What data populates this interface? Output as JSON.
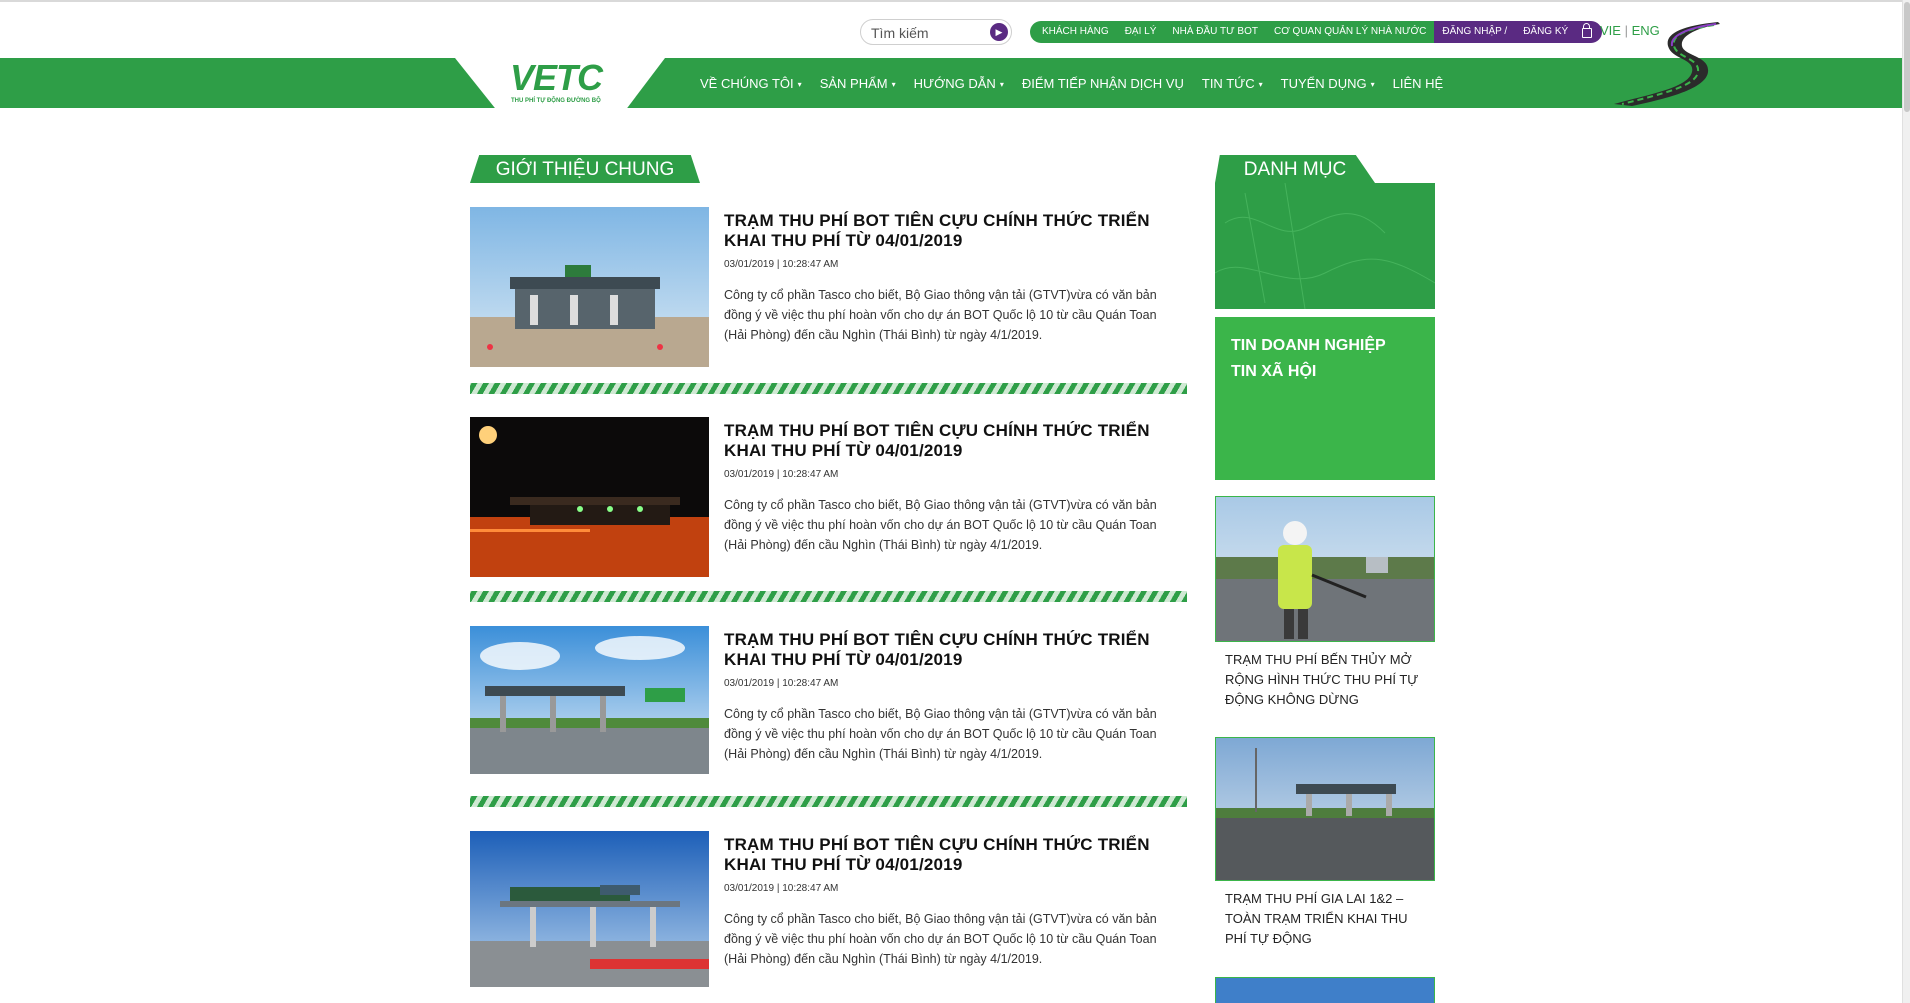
{
  "header": {
    "search": {
      "placeholder": "Tìm kiếm"
    },
    "quick_links": [
      "KHÁCH HÀNG",
      "ĐẠI LÝ",
      "NHÀ ĐẦU TƯ BOT",
      "CƠ QUAN QUẢN LÝ NHÀ NƯỚC"
    ],
    "account": {
      "login": "ĐĂNG NHẬP /",
      "register": "ĐĂNG KÝ"
    },
    "lang": {
      "vie": "VIE",
      "sep": "|",
      "eng": "ENG"
    },
    "brand_color": "#2e9e47",
    "accent_color": "#5a2a82"
  },
  "logo": {
    "mark": "VETC",
    "tagline": "THU PHÍ TỰ ĐỘNG ĐƯỜNG BỘ"
  },
  "nav": [
    {
      "label": "VỀ CHÚNG TÔI",
      "dropdown": true
    },
    {
      "label": "SẢN PHẨM",
      "dropdown": true
    },
    {
      "label": "HƯỚNG DẪN",
      "dropdown": true
    },
    {
      "label": "ĐIỂM TIẾP NHẬN DỊCH VỤ",
      "dropdown": false
    },
    {
      "label": "TIN TỨC",
      "dropdown": true
    },
    {
      "label": "TUYỂN DỤNG",
      "dropdown": true
    },
    {
      "label": "LIÊN HỆ",
      "dropdown": false
    }
  ],
  "main": {
    "section_title": "GIỚI THIỆU CHUNG",
    "posts": [
      {
        "title": "TRẠM THU PHÍ BOT TIÊN CỰU CHÍNH THỨC TRIỂN KHAI THU PHÍ TỪ 04/01/2019",
        "date": "03/01/2019 | 10:28:47 AM",
        "excerpt": "Công ty cổ phần Tasco cho biết, Bộ Giao thông vận tải (GTVT)vừa có văn bản đồng ý về việc thu phí hoàn vốn cho dự án BOT Quốc lộ 10 từ cầu Quán Toan (Hải Phòng) đến cầu Nghìn (Thái Bình) từ ngày 4/1/2019."
      },
      {
        "title": "TRẠM THU PHÍ BOT TIÊN CỰU CHÍNH THỨC TRIỂN KHAI THU PHÍ TỪ 04/01/2019",
        "date": "03/01/2019 | 10:28:47 AM",
        "excerpt": "Công ty cổ phần Tasco cho biết, Bộ Giao thông vận tải (GTVT)vừa có văn bản đồng ý về việc thu phí hoàn vốn cho dự án BOT Quốc lộ 10 từ cầu Quán Toan (Hải Phòng) đến cầu Nghìn (Thái Bình) từ ngày 4/1/2019."
      },
      {
        "title": "TRẠM THU PHÍ BOT TIÊN CỰU CHÍNH THỨC TRIỂN KHAI THU PHÍ TỪ 04/01/2019",
        "date": "03/01/2019 | 10:28:47 AM",
        "excerpt": "Công ty cổ phần Tasco cho biết, Bộ Giao thông vận tải (GTVT)vừa có văn bản đồng ý về việc thu phí hoàn vốn cho dự án BOT Quốc lộ 10 từ cầu Quán Toan (Hải Phòng) đến cầu Nghìn (Thái Bình) từ ngày 4/1/2019."
      },
      {
        "title": "TRẠM THU PHÍ BOT TIÊN CỰU CHÍNH THỨC TRIỂN KHAI THU PHÍ TỪ 04/01/2019",
        "date": "03/01/2019 | 10:28:47 AM",
        "excerpt": "Công ty cổ phần Tasco cho biết, Bộ Giao thông vận tải (GTVT)vừa có văn bản đồng ý về việc thu phí hoàn vốn cho dự án BOT Quốc lộ 10 từ cầu Quán Toan (Hải Phòng) đến cầu Nghìn (Thái Bình) từ ngày 4/1/2019."
      }
    ]
  },
  "sidebar": {
    "title": "DANH MỤC",
    "categories": [
      "TIN DOANH NGHIỆP",
      "TIN XÃ HỘI"
    ],
    "cards": [
      {
        "caption": "TRẠM THU PHÍ BẾN THỦY MỞ RỘNG HÌNH THỨC THU PHÍ TỰ ĐỘNG KHÔNG DỪNG"
      },
      {
        "caption": "TRẠM THU PHÍ GIA LAI 1&2 – TOÀN TRẠM TRIỂN KHAI THU PHÍ TỰ ĐỘNG"
      }
    ]
  }
}
